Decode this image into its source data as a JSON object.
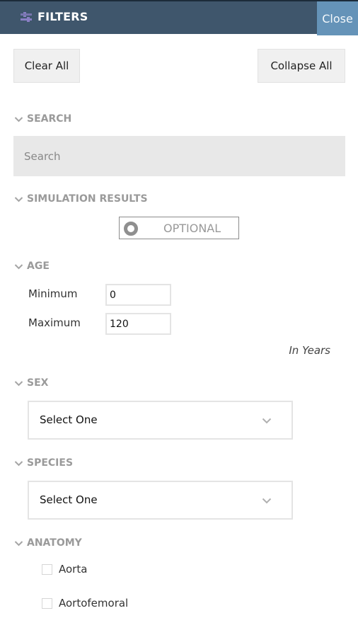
{
  "header": {
    "title": "FILTERS",
    "icon": "sliders-icon",
    "icon_color": "#8a7fc4",
    "background": "#3f566c",
    "close_label": "Close",
    "close_background": "#6593b8"
  },
  "toolbar": {
    "clear_all_label": "Clear All",
    "collapse_all_label": "Collapse All"
  },
  "sections": {
    "search": {
      "title": "SEARCH",
      "placeholder": "Search",
      "value": ""
    },
    "simulation_results": {
      "title": "SIMULATION RESULTS",
      "toggle_label": "OPTIONAL",
      "toggle_on": false
    },
    "age": {
      "title": "AGE",
      "min_label": "Minimum",
      "min_value": "0",
      "max_label": "Maximum",
      "max_value": "120",
      "unit_note": "In Years"
    },
    "sex": {
      "title": "SEX",
      "selected": "Select One"
    },
    "species": {
      "title": "SPECIES",
      "selected": "Select One"
    },
    "anatomy": {
      "title": "ANATOMY",
      "options": [
        {
          "label": "Aorta",
          "checked": false
        },
        {
          "label": "Aortofemoral",
          "checked": false
        }
      ]
    }
  },
  "icons": {
    "section_toggle": "chevron-down-icon",
    "select_toggle": "chevron-down-icon"
  }
}
